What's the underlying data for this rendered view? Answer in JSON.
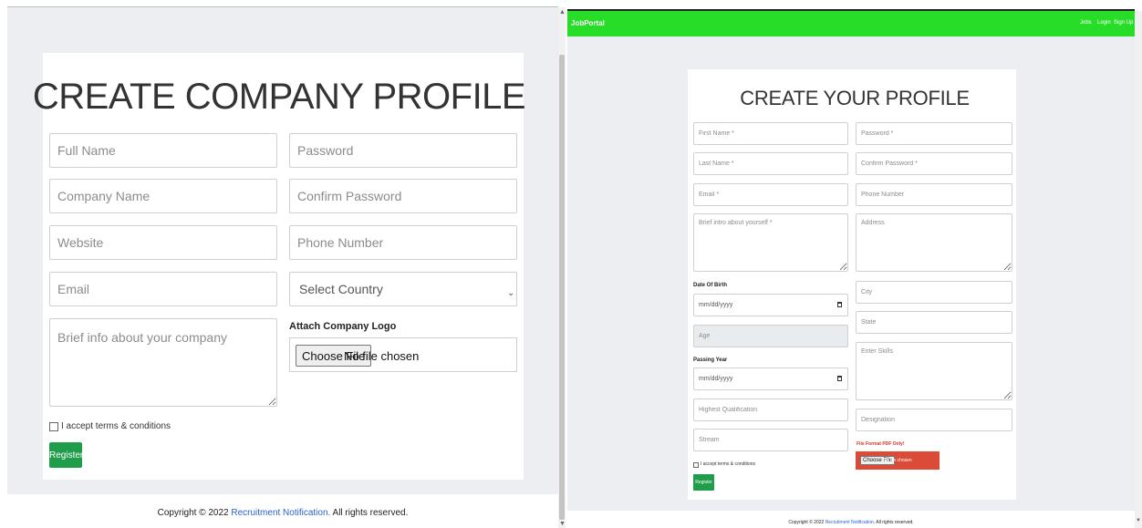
{
  "left": {
    "title": "CREATE COMPANY PROFILE",
    "placeholders": {
      "full_name": "Full Name",
      "password": "Password",
      "company_name": "Company Name",
      "confirm_password": "Confirm Password",
      "website": "Website",
      "phone": "Phone Number",
      "email": "Email",
      "brief": "Brief info about your company"
    },
    "country_select": {
      "selected": "Select Country"
    },
    "logo_label": "Attach Company Logo",
    "file_button": "Choose File",
    "file_status": "No file chosen",
    "terms_label": "I accept terms & conditions",
    "register_label": "Register",
    "footer": {
      "prefix": "Copyright © 2022 ",
      "link": "Recruitment Notification.",
      "suffix": " All rights reserved."
    }
  },
  "right": {
    "brand": "JobPortal",
    "nav": [
      "Jobs",
      "Login",
      "Sign Up"
    ],
    "title": "CREATE YOUR PROFILE",
    "placeholders": {
      "first_name": "First Name *",
      "password": "Password *",
      "last_name": "Last Name *",
      "confirm_password": "Confirm Password *",
      "email": "Email *",
      "phone": "Phone Number",
      "intro": "Brief intro about yourself *",
      "address": "Address",
      "city": "City",
      "age": "Age",
      "state": "State",
      "skills": "Enter Skills",
      "qualification": "Highest Qualification",
      "designation": "Designation",
      "stream": "Stream"
    },
    "dob_label": "Date Of Birth",
    "dob_value": "mm/dd/yyyy",
    "passing_label": "Passing Year",
    "passing_value": "mm/dd/yyyy",
    "file_format_label": "File Format PDF Only!",
    "file_button": "Choose File",
    "file_status": "No file chosen",
    "terms_label": "I accept terms & conditions",
    "register_label": "Register",
    "footer": {
      "prefix": "Copyright © 2022 ",
      "link": "Recruitment Notification.",
      "suffix": " All rights reserved."
    }
  },
  "colors": {
    "navbar": "#27dd28",
    "register": "#1f9d4a",
    "file_bar": "#dc4a38",
    "link": "#2a62c9"
  }
}
